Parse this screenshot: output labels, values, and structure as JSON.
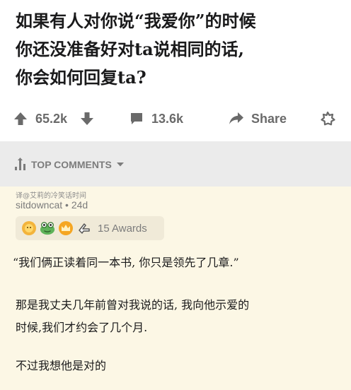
{
  "post": {
    "title_lines": [
      "如果有人对你说“我爱你”的时候",
      "你还没准备好对ta说相同的话,",
      "你会如何回复ta?"
    ],
    "upvotes": "65.2k",
    "comments": "13.6k",
    "share_label": "Share"
  },
  "comments_header": {
    "sort_label": "TOP COMMENTS"
  },
  "comment": {
    "watermark": "译@艾莉的冷笑话时间",
    "author_meta": "sitdowncat • 24d",
    "awards_label": "15 Awards",
    "paragraph_1": "“我们俩正读着同一本书, 你只是领先了几章.”",
    "paragraph_2_lines": [
      "那是我丈夫几年前曾对我说的话, 我向他示爱的",
      "时候,我们才约会了几个月."
    ],
    "paragraph_3": "不过我想他是对的"
  },
  "colors": {
    "muted": "#7c7c7c",
    "bar_bg": "#ebebeb",
    "comment_bg": "#fcf7e5",
    "awards_bg": "#f0ead8"
  },
  "icons": [
    "upvote-arrow-icon",
    "downvote-arrow-icon",
    "comment-bubble-icon",
    "share-arrow-icon",
    "award-star-icon",
    "sort-icon",
    "chevron-down-icon",
    "sun-award-icon",
    "frog-award-icon",
    "crown-award-icon",
    "gesture-award-icon"
  ]
}
